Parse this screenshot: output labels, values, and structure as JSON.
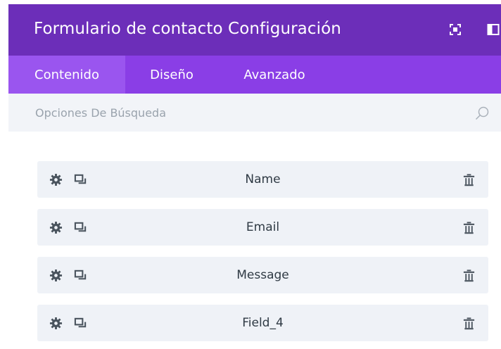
{
  "header": {
    "title": "Formulario de contacto Configuración",
    "icons": [
      "expand-icon",
      "split-view-icon"
    ],
    "background": "#6c2eb9"
  },
  "tabs": [
    {
      "label": "Contenido",
      "active": true
    },
    {
      "label": "Diseño",
      "active": false
    },
    {
      "label": "Avanzado",
      "active": false
    }
  ],
  "search": {
    "placeholder": "Opciones De Búsqueda",
    "value": ""
  },
  "fields": [
    {
      "label": "Name",
      "icons": [
        "gear-icon",
        "duplicate-icon",
        "trash-icon"
      ]
    },
    {
      "label": "Email",
      "icons": [
        "gear-icon",
        "duplicate-icon",
        "trash-icon"
      ]
    },
    {
      "label": "Message",
      "icons": [
        "gear-icon",
        "duplicate-icon",
        "trash-icon"
      ]
    },
    {
      "label": "Field_4",
      "icons": [
        "gear-icon",
        "duplicate-icon",
        "trash-icon"
      ]
    }
  ],
  "colors": {
    "accent": "#8a3ee6",
    "active_tab": "#9a55ef",
    "row_bg": "#eff2f7"
  }
}
